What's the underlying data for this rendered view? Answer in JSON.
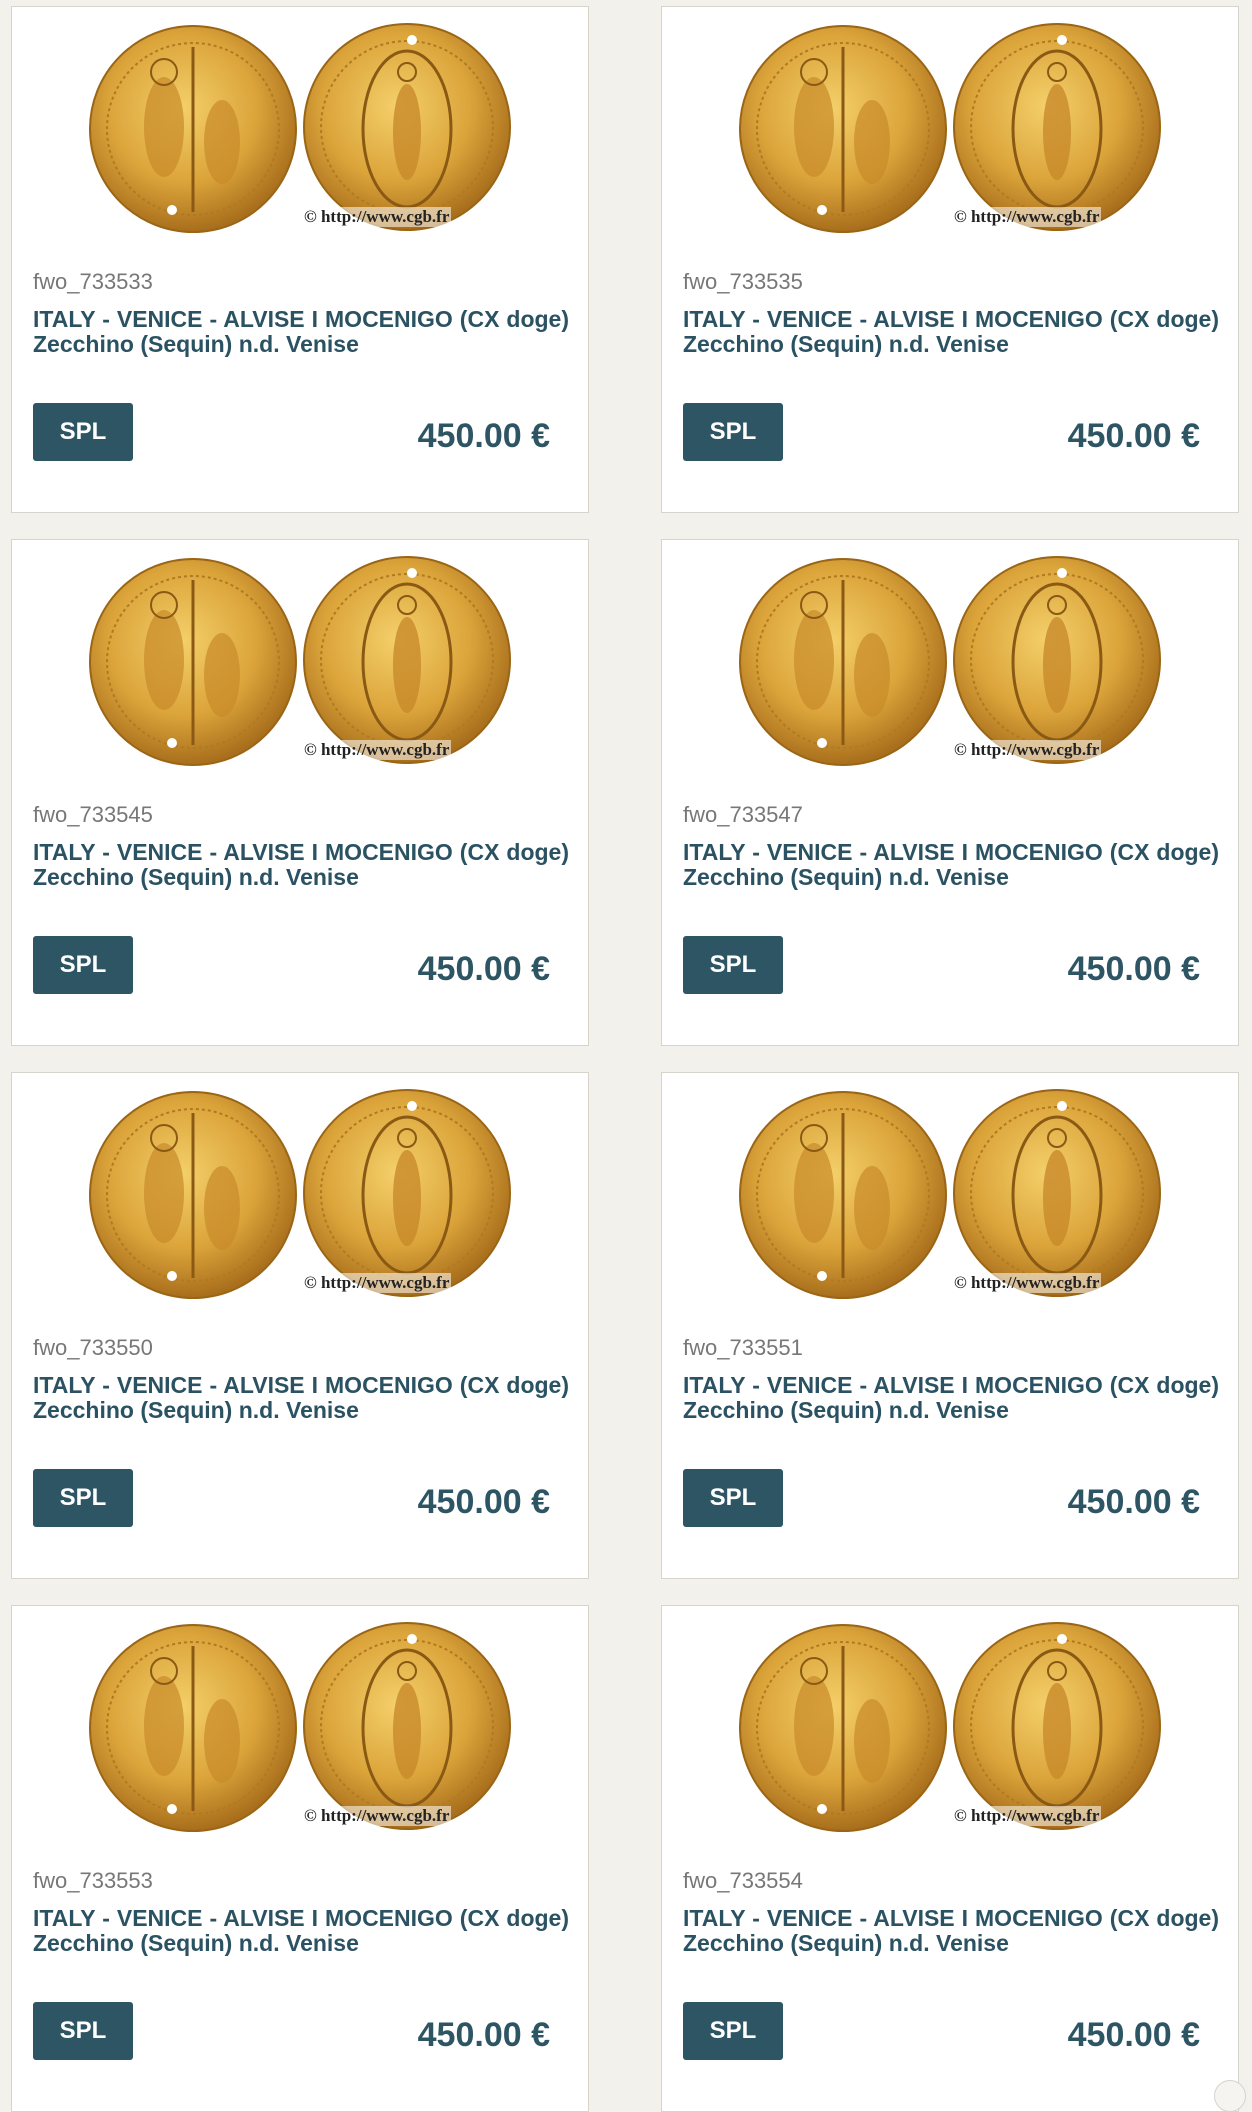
{
  "listing": {
    "currency_symbol": "€",
    "image_credit": "© http://www.cgb.fr",
    "products": [
      {
        "sku": "fwo_733533",
        "title": "ITALY - VENICE - ALVISE I MOCENIGO (CX doge) Zecchino (Sequin) n.d. Venise",
        "grade": "SPL",
        "price": "450.00 €"
      },
      {
        "sku": "fwo_733535",
        "title": "ITALY - VENICE - ALVISE I MOCENIGO (CX doge) Zecchino (Sequin) n.d. Venise",
        "grade": "SPL",
        "price": "450.00 €"
      },
      {
        "sku": "fwo_733545",
        "title": "ITALY - VENICE - ALVISE I MOCENIGO (CX doge) Zecchino (Sequin) n.d. Venise",
        "grade": "SPL",
        "price": "450.00 €"
      },
      {
        "sku": "fwo_733547",
        "title": "ITALY - VENICE - ALVISE I MOCENIGO (CX doge) Zecchino (Sequin) n.d. Venise",
        "grade": "SPL",
        "price": "450.00 €"
      },
      {
        "sku": "fwo_733550",
        "title": "ITALY - VENICE - ALVISE I MOCENIGO (CX doge) Zecchino (Sequin) n.d. Venise",
        "grade": "SPL",
        "price": "450.00 €"
      },
      {
        "sku": "fwo_733551",
        "title": "ITALY - VENICE - ALVISE I MOCENIGO (CX doge) Zecchino (Sequin) n.d. Venise",
        "grade": "SPL",
        "price": "450.00 €"
      },
      {
        "sku": "fwo_733553",
        "title": "ITALY - VENICE - ALVISE I MOCENIGO (CX doge) Zecchino (Sequin) n.d. Venise",
        "grade": "SPL",
        "price": "450.00 €"
      },
      {
        "sku": "fwo_733554",
        "title": "ITALY - VENICE - ALVISE I MOCENIGO (CX doge) Zecchino (Sequin) n.d. Venise",
        "grade": "SPL",
        "price": "450.00 €"
      }
    ]
  },
  "colors": {
    "page_background": "#f2f1ec",
    "title_text": "#2b5262",
    "grade_badge": "#2e5563",
    "price_text": "#2e5563",
    "coin_gold": "#d9a53a"
  },
  "icons": {
    "product_image": "gold-coin-pair-image",
    "corner": "scroll-circle-icon"
  }
}
